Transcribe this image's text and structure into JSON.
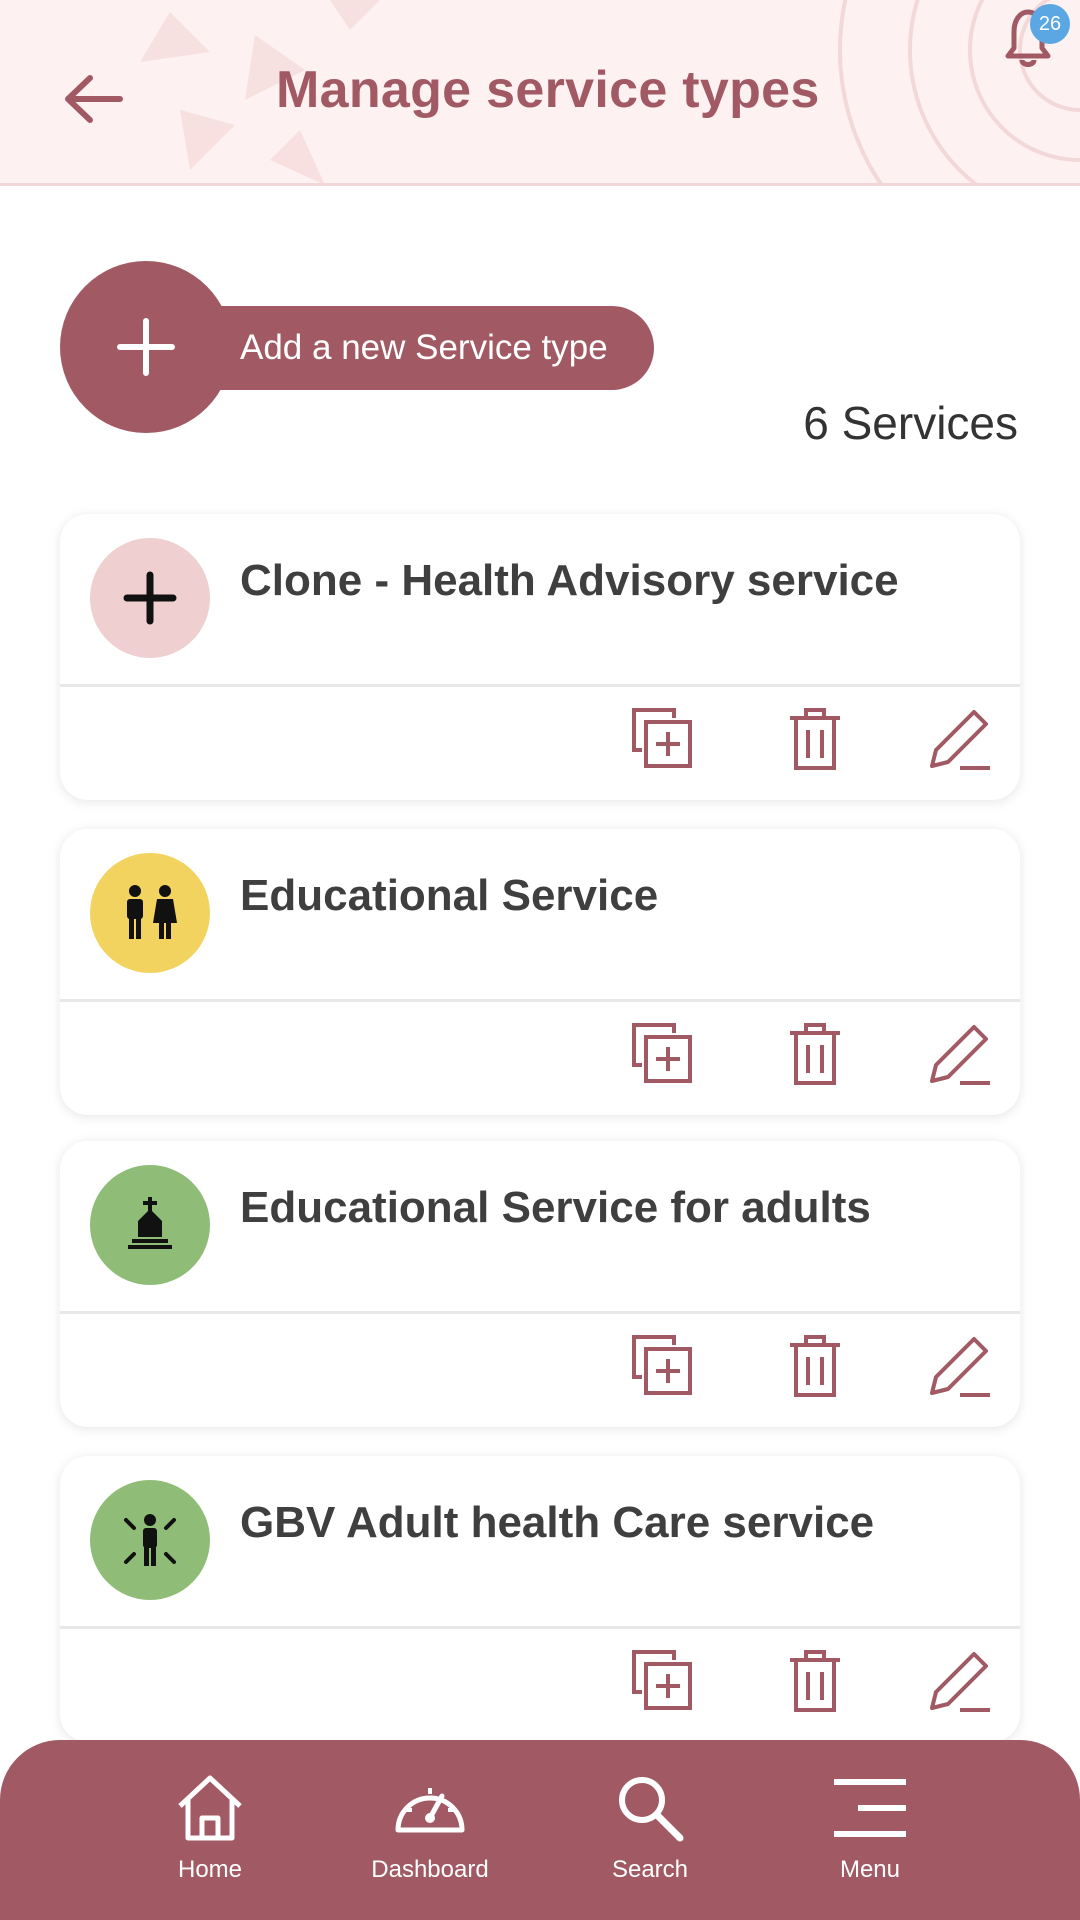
{
  "header": {
    "title": "Manage service types",
    "back_icon": "arrow-left-icon",
    "notification_icon": "bell-icon",
    "notification_count": "26"
  },
  "add_button": {
    "label": "Add a new Service type",
    "icon": "plus-icon"
  },
  "service_count": "6 Services",
  "services": [
    {
      "name": "Clone - Health Advisory service",
      "icon": "plus-icon",
      "color": "#efcfcf"
    },
    {
      "name": "Educational Service",
      "icon": "man-woman-icon",
      "color": "#f2d35f"
    },
    {
      "name": "Educational Service for adults",
      "icon": "church-icon",
      "color": "#8fbd78"
    },
    {
      "name": "GBV Adult health Care service",
      "icon": "person-alert-icon",
      "color": "#8fbd78"
    }
  ],
  "actions": {
    "duplicate_icon": "duplicate-icon",
    "delete_icon": "trash-icon",
    "edit_icon": "pencil-icon"
  },
  "bottom_nav": [
    {
      "label": "Home",
      "icon": "home-icon"
    },
    {
      "label": "Dashboard",
      "icon": "dashboard-icon"
    },
    {
      "label": "Search",
      "icon": "search-icon"
    },
    {
      "label": "Menu",
      "icon": "menu-icon"
    }
  ],
  "colors": {
    "brand": "#a15a64",
    "header_bg": "#fdf1f1",
    "badge": "#5aa7e3"
  }
}
